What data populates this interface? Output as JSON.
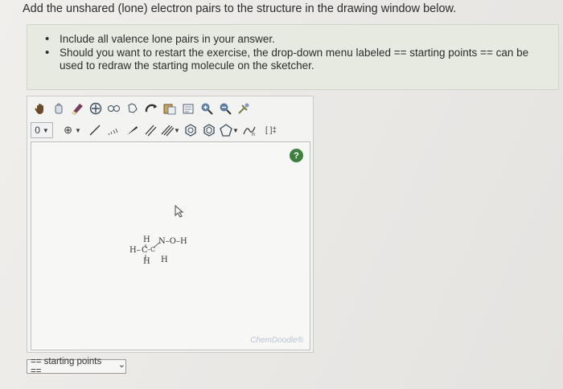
{
  "heading": "Add the unshared (lone) electron pairs to the structure in the drawing window below.",
  "instructions": [
    "Include all valence lone pairs in your answer.",
    "Should you want to restart the exercise, the drop-down menu labeled == starting points == can be used to redraw the starting molecule on the sketcher."
  ],
  "toolbar_row1": [
    "hand-icon",
    "lasso-icon",
    "eraser-icon",
    "center-icon",
    "ring-group-icon",
    "template-icon",
    "rotate-icon",
    "paste-icon",
    "clear-icon",
    "zoom-in-icon",
    "zoom-out-icon",
    "settings-icon"
  ],
  "toolbar_row2": {
    "charge_label": "0",
    "radical_label": "⊕",
    "bracket_label": "[ ]‡"
  },
  "canvas": {
    "help_label": "?",
    "watermark": "ChemDoodle®",
    "molecule": {
      "h_top": "H",
      "h_left": "H–",
      "c": "C",
      "bond": "–C",
      "n_oh": "N–O–H",
      "h_bottom": "H",
      "h_right": "H"
    }
  },
  "starting_points": {
    "label": "== starting points ==",
    "chevron": "⌄"
  }
}
